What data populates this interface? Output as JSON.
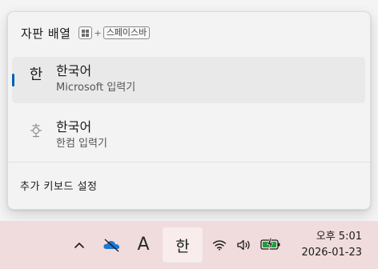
{
  "flyout": {
    "title": "자판 배열",
    "shortcut": {
      "plus": "+",
      "key": "스페이스바"
    },
    "items": [
      {
        "glyph": "한",
        "language": "한국어",
        "ime_name": "Microsoft 입력기",
        "selected": true
      },
      {
        "glyph_icon": "hanja-ime-icon",
        "language": "한국어",
        "ime_name": "한컴 입력기",
        "selected": false
      }
    ],
    "more_link": "추가 키보드 설정"
  },
  "taskbar": {
    "chevron_icon": "chevron-up-icon",
    "onedrive_icon": "onedrive-paused-icon",
    "input_mode": "A",
    "ime_indicator": "한",
    "wifi_icon": "wifi-icon",
    "volume_icon": "volume-icon",
    "battery_icon": "battery-charging-icon",
    "clock": {
      "time": "오후 5:01",
      "date": "2026-01-23"
    }
  },
  "colors": {
    "accent": "#005fb8",
    "taskbar_bg": "#f0dcdd",
    "flyout_bg": "#f3f3f3",
    "battery_green": "#1a9e3c",
    "onedrive_blue": "#1c78d4"
  }
}
